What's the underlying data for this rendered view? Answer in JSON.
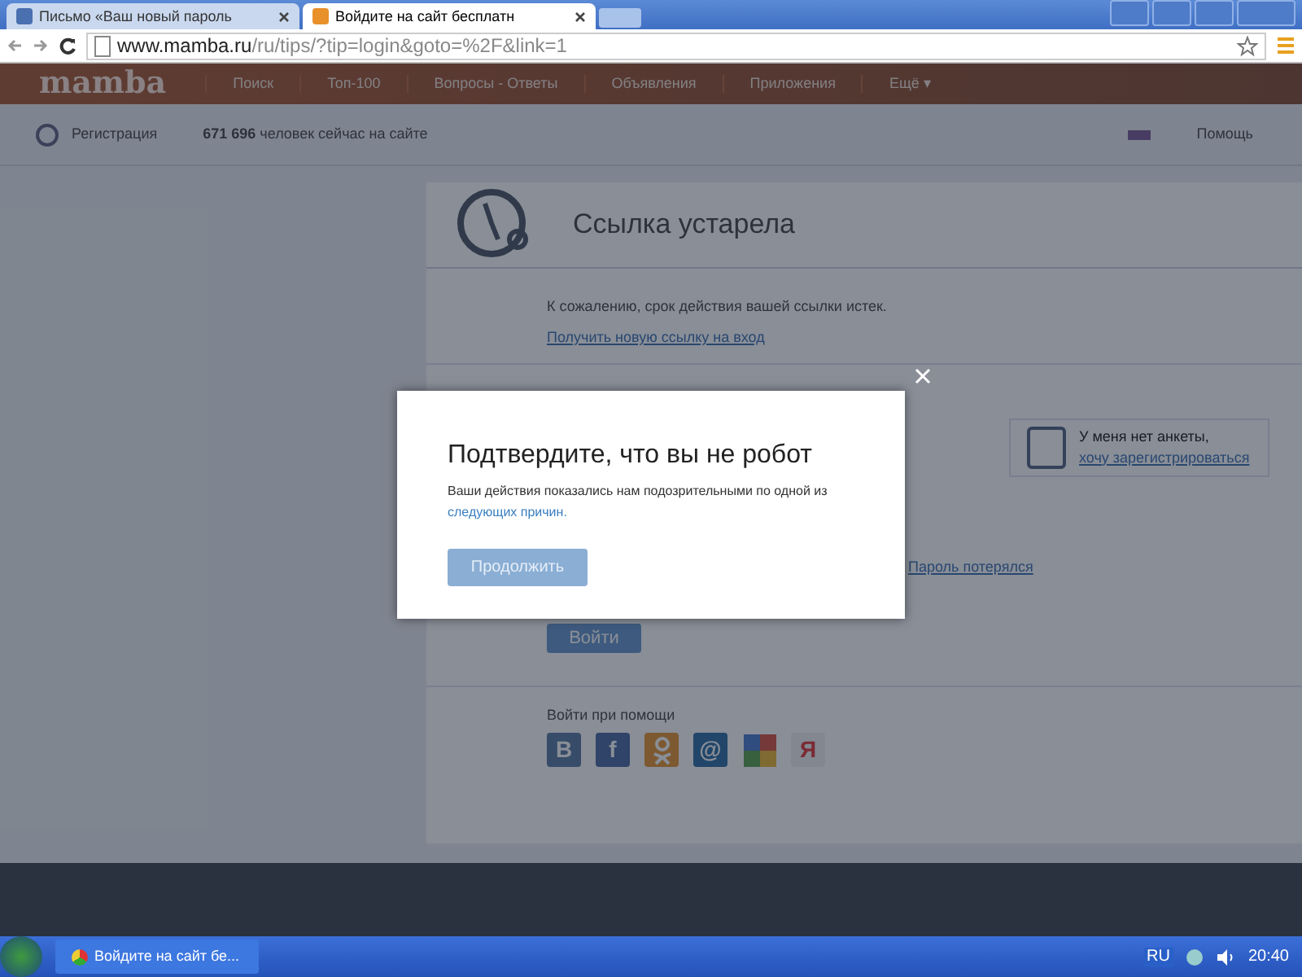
{
  "browser": {
    "tabs": [
      {
        "title": "Письмо «Ваш новый пароль",
        "selected": false
      },
      {
        "title": "Войдите на сайт бесплатн",
        "selected": true
      }
    ],
    "url_host": "www.mamba.ru",
    "url_path": "/ru/tips/?tip=login&goto=%2F&link=1"
  },
  "site": {
    "logo": "mamba",
    "nav": [
      "Поиск",
      "Топ-100",
      "Вопросы - Ответы",
      "Объявления",
      "Приложения",
      "Ещё ▾"
    ],
    "register": "Регистрация",
    "online": "**671 696** человек сейчас на сайте",
    "help": "Помощь"
  },
  "card": {
    "title": "Ссылка устарела",
    "message": "К сожалению, срок действия вашей ссылки истек.",
    "new_link": "Получить новую ссылку на вход",
    "no_profile": "У меня нет анкеты,",
    "register_link": "хочу зарегистрироваться",
    "lost_password": "Пароль потерялся",
    "login_button": "Войти",
    "social_label": "Войти при помощи",
    "social": [
      {
        "kind": "vk",
        "label": "В"
      },
      {
        "kind": "fb",
        "label": "f"
      },
      {
        "kind": "ok"
      },
      {
        "kind": "mail",
        "label": "@"
      },
      {
        "kind": "google"
      },
      {
        "kind": "yandex",
        "label": "Я"
      }
    ]
  },
  "modal": {
    "title": "Подтвердите, что вы не робот",
    "text": "Ваши действия показались нам подозрительными по одной из",
    "link": "следующих причин.",
    "button": "Продолжить"
  },
  "taskbar": {
    "window": "Войдите на сайт бе...",
    "language": "RU",
    "time": "20:40"
  }
}
